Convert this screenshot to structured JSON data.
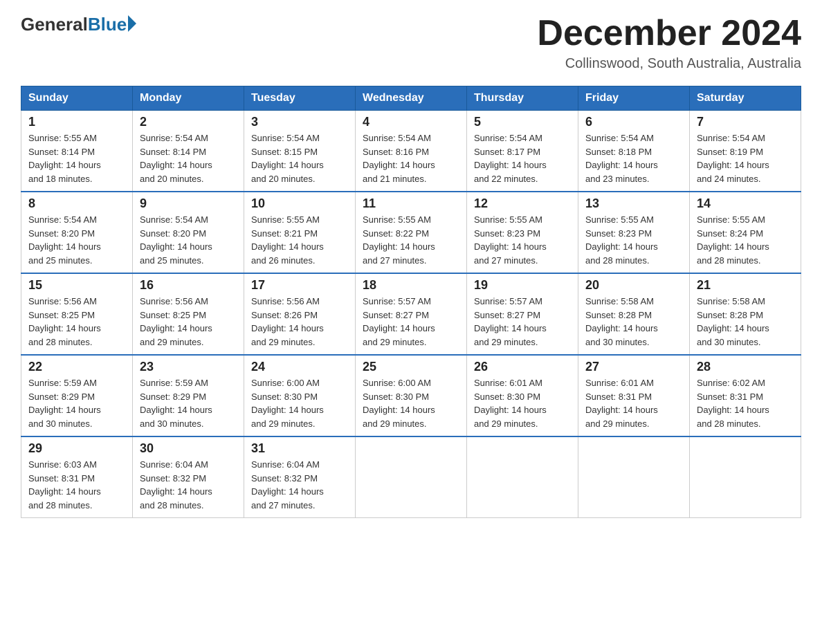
{
  "header": {
    "logo_general": "General",
    "logo_blue": "Blue",
    "month_title": "December 2024",
    "location": "Collinswood, South Australia, Australia"
  },
  "weekdays": [
    "Sunday",
    "Monday",
    "Tuesday",
    "Wednesday",
    "Thursday",
    "Friday",
    "Saturday"
  ],
  "weeks": [
    [
      {
        "day": "1",
        "sunrise": "5:55 AM",
        "sunset": "8:14 PM",
        "daylight": "14 hours and 18 minutes."
      },
      {
        "day": "2",
        "sunrise": "5:54 AM",
        "sunset": "8:14 PM",
        "daylight": "14 hours and 20 minutes."
      },
      {
        "day": "3",
        "sunrise": "5:54 AM",
        "sunset": "8:15 PM",
        "daylight": "14 hours and 20 minutes."
      },
      {
        "day": "4",
        "sunrise": "5:54 AM",
        "sunset": "8:16 PM",
        "daylight": "14 hours and 21 minutes."
      },
      {
        "day": "5",
        "sunrise": "5:54 AM",
        "sunset": "8:17 PM",
        "daylight": "14 hours and 22 minutes."
      },
      {
        "day": "6",
        "sunrise": "5:54 AM",
        "sunset": "8:18 PM",
        "daylight": "14 hours and 23 minutes."
      },
      {
        "day": "7",
        "sunrise": "5:54 AM",
        "sunset": "8:19 PM",
        "daylight": "14 hours and 24 minutes."
      }
    ],
    [
      {
        "day": "8",
        "sunrise": "5:54 AM",
        "sunset": "8:20 PM",
        "daylight": "14 hours and 25 minutes."
      },
      {
        "day": "9",
        "sunrise": "5:54 AM",
        "sunset": "8:20 PM",
        "daylight": "14 hours and 25 minutes."
      },
      {
        "day": "10",
        "sunrise": "5:55 AM",
        "sunset": "8:21 PM",
        "daylight": "14 hours and 26 minutes."
      },
      {
        "day": "11",
        "sunrise": "5:55 AM",
        "sunset": "8:22 PM",
        "daylight": "14 hours and 27 minutes."
      },
      {
        "day": "12",
        "sunrise": "5:55 AM",
        "sunset": "8:23 PM",
        "daylight": "14 hours and 27 minutes."
      },
      {
        "day": "13",
        "sunrise": "5:55 AM",
        "sunset": "8:23 PM",
        "daylight": "14 hours and 28 minutes."
      },
      {
        "day": "14",
        "sunrise": "5:55 AM",
        "sunset": "8:24 PM",
        "daylight": "14 hours and 28 minutes."
      }
    ],
    [
      {
        "day": "15",
        "sunrise": "5:56 AM",
        "sunset": "8:25 PM",
        "daylight": "14 hours and 28 minutes."
      },
      {
        "day": "16",
        "sunrise": "5:56 AM",
        "sunset": "8:25 PM",
        "daylight": "14 hours and 29 minutes."
      },
      {
        "day": "17",
        "sunrise": "5:56 AM",
        "sunset": "8:26 PM",
        "daylight": "14 hours and 29 minutes."
      },
      {
        "day": "18",
        "sunrise": "5:57 AM",
        "sunset": "8:27 PM",
        "daylight": "14 hours and 29 minutes."
      },
      {
        "day": "19",
        "sunrise": "5:57 AM",
        "sunset": "8:27 PM",
        "daylight": "14 hours and 29 minutes."
      },
      {
        "day": "20",
        "sunrise": "5:58 AM",
        "sunset": "8:28 PM",
        "daylight": "14 hours and 30 minutes."
      },
      {
        "day": "21",
        "sunrise": "5:58 AM",
        "sunset": "8:28 PM",
        "daylight": "14 hours and 30 minutes."
      }
    ],
    [
      {
        "day": "22",
        "sunrise": "5:59 AM",
        "sunset": "8:29 PM",
        "daylight": "14 hours and 30 minutes."
      },
      {
        "day": "23",
        "sunrise": "5:59 AM",
        "sunset": "8:29 PM",
        "daylight": "14 hours and 30 minutes."
      },
      {
        "day": "24",
        "sunrise": "6:00 AM",
        "sunset": "8:30 PM",
        "daylight": "14 hours and 29 minutes."
      },
      {
        "day": "25",
        "sunrise": "6:00 AM",
        "sunset": "8:30 PM",
        "daylight": "14 hours and 29 minutes."
      },
      {
        "day": "26",
        "sunrise": "6:01 AM",
        "sunset": "8:30 PM",
        "daylight": "14 hours and 29 minutes."
      },
      {
        "day": "27",
        "sunrise": "6:01 AM",
        "sunset": "8:31 PM",
        "daylight": "14 hours and 29 minutes."
      },
      {
        "day": "28",
        "sunrise": "6:02 AM",
        "sunset": "8:31 PM",
        "daylight": "14 hours and 28 minutes."
      }
    ],
    [
      {
        "day": "29",
        "sunrise": "6:03 AM",
        "sunset": "8:31 PM",
        "daylight": "14 hours and 28 minutes."
      },
      {
        "day": "30",
        "sunrise": "6:04 AM",
        "sunset": "8:32 PM",
        "daylight": "14 hours and 28 minutes."
      },
      {
        "day": "31",
        "sunrise": "6:04 AM",
        "sunset": "8:32 PM",
        "daylight": "14 hours and 27 minutes."
      },
      null,
      null,
      null,
      null
    ]
  ],
  "labels": {
    "sunrise": "Sunrise:",
    "sunset": "Sunset:",
    "daylight": "Daylight:"
  }
}
